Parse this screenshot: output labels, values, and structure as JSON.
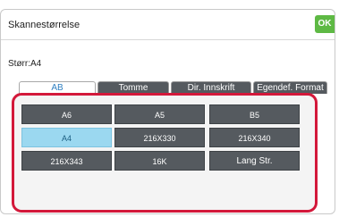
{
  "dialog": {
    "title": "Skannestørrelse",
    "ok_label": "OK",
    "size_label": "Størr:A4"
  },
  "tabs": [
    {
      "label": "AB",
      "active": true
    },
    {
      "label": "Tomme",
      "active": false
    },
    {
      "label": "Dir. Innskrift",
      "active": false
    },
    {
      "label": "Egendef. Format",
      "active": false
    }
  ],
  "sizes": [
    {
      "label": "A6",
      "selected": false
    },
    {
      "label": "A5",
      "selected": false
    },
    {
      "label": "B5",
      "selected": false
    },
    {
      "label": "A4",
      "selected": true
    },
    {
      "label": "216X330",
      "selected": false
    },
    {
      "label": "216X340",
      "selected": false
    },
    {
      "label": "216X343",
      "selected": false
    },
    {
      "label": "16K",
      "selected": false
    },
    {
      "label": "Lang Str.",
      "selected": false
    }
  ],
  "colors": {
    "accent_ok": "#5eb944",
    "highlight_border": "#d3183a",
    "selected_button": "#9bd8f0",
    "button_dark": "#555a5f",
    "active_tab_text": "#2f7fc1"
  }
}
